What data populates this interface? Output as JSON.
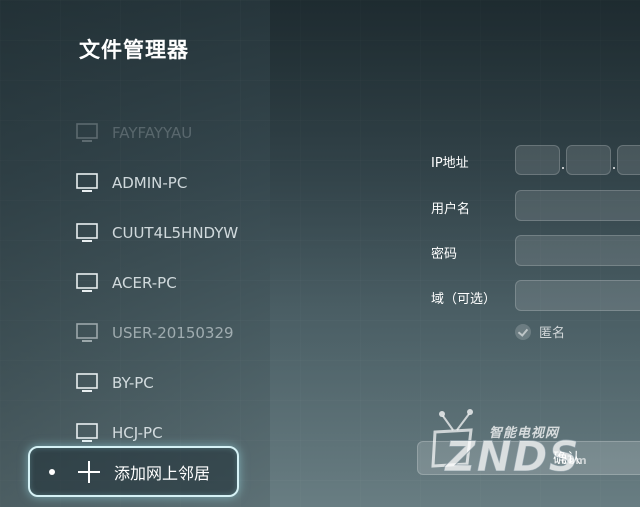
{
  "app": {
    "title": "文件管理器"
  },
  "devices": [
    {
      "name": "FAYFAYYAU",
      "state": "faded"
    },
    {
      "name": "ADMIN-PC",
      "state": "normal"
    },
    {
      "name": "CUUT4L5HNDYW",
      "state": "normal"
    },
    {
      "name": "ACER-PC",
      "state": "normal"
    },
    {
      "name": "USER-20150329",
      "state": "dim"
    },
    {
      "name": "BY-PC",
      "state": "normal"
    },
    {
      "name": "HCJ-PC",
      "state": "normal"
    }
  ],
  "add_neighbor": {
    "label": "添加网上邻居"
  },
  "form": {
    "ip_label": "IP地址",
    "username_label": "用户名",
    "password_label": "密码",
    "domain_label": "域（可选）",
    "anonymous_label": "匿名",
    "confirm_label": "确认"
  },
  "watermark": {
    "sub": "智能电视网",
    "main": "ZNDS",
    "suffix": ".com"
  },
  "icons": {
    "device": "monitor-icon",
    "add": "plus-icon",
    "anonymous": "check-icon",
    "watermark": "tv-antenna-icon"
  }
}
